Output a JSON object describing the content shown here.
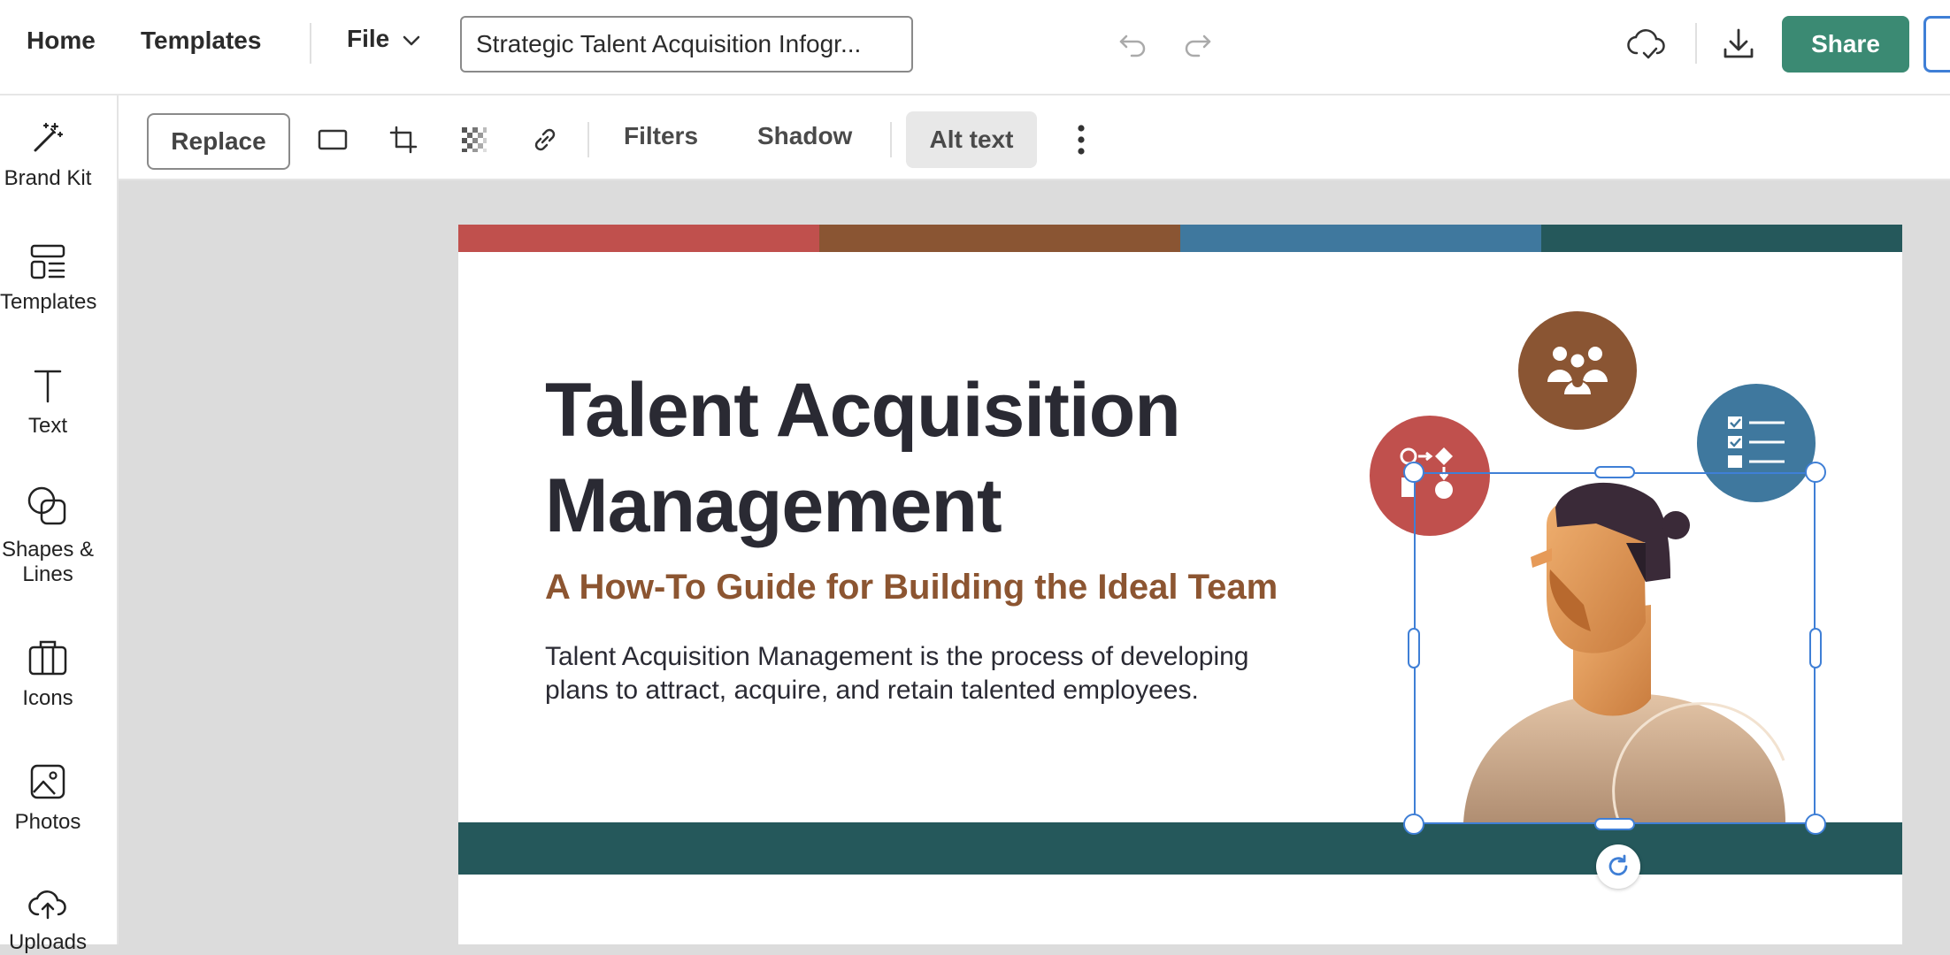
{
  "topbar": {
    "home_label": "Home",
    "templates_label": "Templates",
    "file_label": "File",
    "document_title": "Strategic Talent Acquisition Infogr...",
    "share_label": "Share"
  },
  "sidebar": {
    "items": [
      {
        "label": "Brand Kit",
        "icon": "magic-wand-icon"
      },
      {
        "label": "Templates",
        "icon": "templates-icon"
      },
      {
        "label": "Text",
        "icon": "text-icon"
      },
      {
        "label": "Shapes &",
        "label2": "Lines",
        "icon": "shapes-icon"
      },
      {
        "label": "Icons",
        "icon": "briefcase-icon"
      },
      {
        "label": "Photos",
        "icon": "photo-icon"
      },
      {
        "label": "Uploads",
        "icon": "upload-cloud-icon"
      }
    ]
  },
  "image_toolbar": {
    "replace_label": "Replace",
    "filters_label": "Filters",
    "shadow_label": "Shadow",
    "alt_text_label": "Alt text"
  },
  "canvas": {
    "headline_line1": "Talent Acquisition",
    "headline_line2": "Management",
    "subheadline": "A How-To Guide for Building the Ideal Team",
    "body_line1": "Talent Acquisition Management is the process of developing",
    "body_line2": "plans to attract, acquire, and retain talented employees.",
    "stripe_colors": [
      "#c0504d",
      "#8a5533",
      "#3f789e",
      "#25585b"
    ],
    "footer_color": "#25585b"
  },
  "colors": {
    "accent": "#3b8a73",
    "selection": "#3f7fd6",
    "subheadline": "#8c5531"
  }
}
